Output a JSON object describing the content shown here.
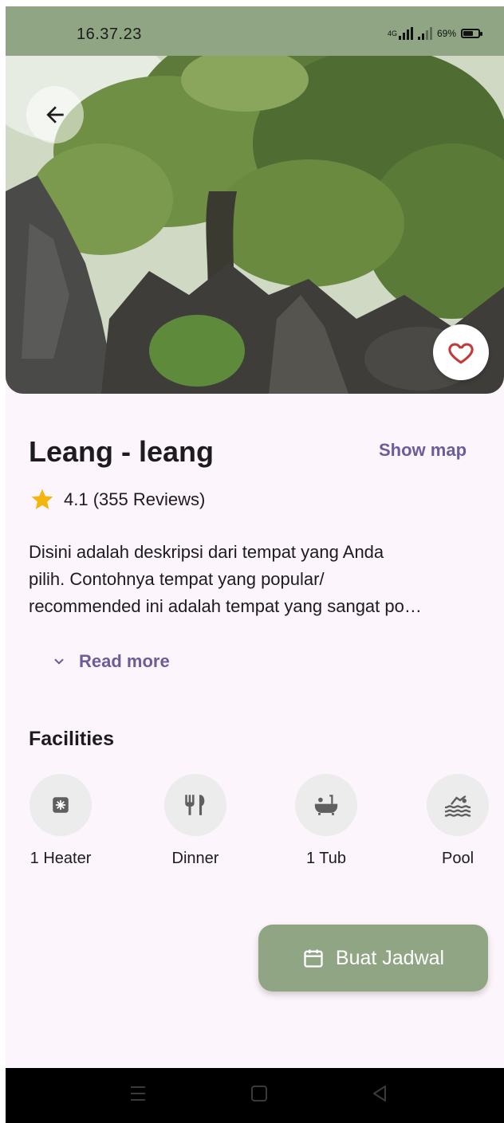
{
  "status_bar": {
    "time": "16.37.23",
    "network": "4G",
    "battery": "69%",
    "battery_level": 0.69
  },
  "place": {
    "name": "Leang - leang",
    "show_map_label": "Show map",
    "rating_text": "4.1 (355 Reviews)",
    "description_lines": [
      "Disini adalah deskripsi dari tempat yang Anda",
      "pilih. Contohnya tempat yang popular/",
      "recommended ini adalah tempat yang sangat po…"
    ],
    "read_more_label": "Read more"
  },
  "facilities": {
    "title": "Facilities",
    "items": [
      {
        "label": "1 Heater",
        "icon": "heater-icon"
      },
      {
        "label": "Dinner",
        "icon": "dinner-icon"
      },
      {
        "label": "1 Tub",
        "icon": "bathtub-icon"
      },
      {
        "label": "Pool",
        "icon": "pool-icon"
      }
    ]
  },
  "cta": {
    "label": "Buat Jadwal",
    "icon": "calendar-icon"
  },
  "colors": {
    "accent": "#8fa583",
    "link": "#6b5e98",
    "background": "#fcf5fb",
    "star": "#f5b50f"
  }
}
